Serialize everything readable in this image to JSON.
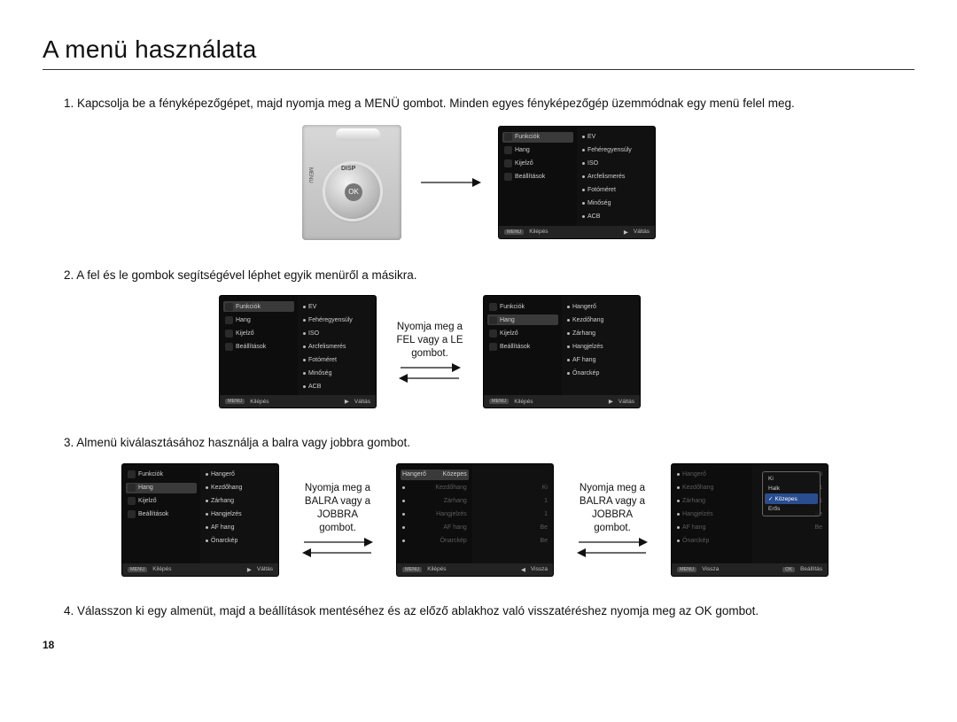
{
  "title": "A menü használata",
  "steps": {
    "s1": "1. Kapcsolja be a fényképezőgépet, majd nyomja meg a MENÜ gombot. Minden egyes fényképezőgép üzemmódnak egy menü felel meg.",
    "s2": "2. A fel és le gombok segítségével léphet egyik menüről a másikra.",
    "s3": "3. Almenü kiválasztásához használja a balra vagy jobbra gombot.",
    "s4": "4. Válasszon ki egy almenüt, majd a beállítások mentéséhez és az előző ablakhoz való visszatéréshez nyomja meg az OK gombot."
  },
  "camera": {
    "disp": "DISP",
    "ok": "OK",
    "menu": "MENU"
  },
  "arrows": {
    "a2": "Nyomja meg a FEL vagy a LE gombot.",
    "a3a": "Nyomja meg a BALRA vagy a JOBBRA gombot.",
    "a3b": "Nyomja meg a BALRA vagy a JOBBRA gombot."
  },
  "menu_left_main": [
    "Funkciók",
    "Hang",
    "Kijelző",
    "Beállítások"
  ],
  "menu_right_func": [
    "EV",
    "Fehéregyensúly",
    "ISO",
    "Arcfelismerés",
    "Fotóméret",
    "Minőség",
    "ACB"
  ],
  "menu_right_sound": [
    "Hangerő",
    "Kezdőhang",
    "Zárhang",
    "Hangjelzés",
    "AF hang",
    "Önarckép"
  ],
  "menu_sound_values": {
    "Hangerő": "Közepes",
    "Kezdőhang": "Ki",
    "Zárhang": "1",
    "Hangjelzés": "1",
    "AF hang": "Be",
    "Önarckép": "Be"
  },
  "volume_options": [
    "Ki",
    "Halk",
    "Közepes",
    "Erős"
  ],
  "volume_selected": "Közepes",
  "footer": {
    "menu_btn": "MENU",
    "exit": "Kilépés",
    "switch": "Váltás",
    "back": "Vissza",
    "ok_btn": "OK",
    "set": "Beállítás",
    "left_icon": "◀",
    "right_icon": "▶"
  },
  "page_number": "18"
}
